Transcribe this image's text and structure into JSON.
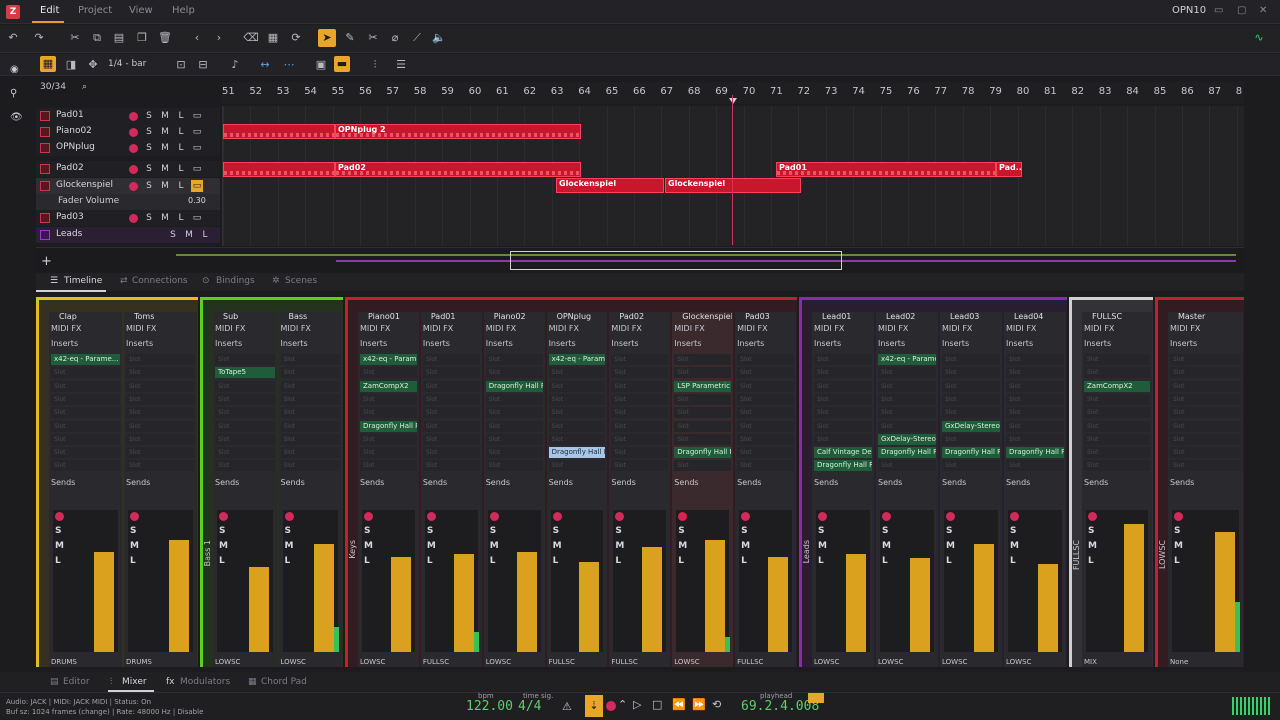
{
  "app": {
    "window_title": "OPN10"
  },
  "menu": {
    "edit": "Edit",
    "project": "Project",
    "view": "View",
    "help": "Help"
  },
  "toolbar2": {
    "snap": "1/4 - bar",
    "track_count": "30/34"
  },
  "ruler": {
    "bars": [
      "51",
      "52",
      "53",
      "54",
      "55",
      "56",
      "57",
      "58",
      "59",
      "60",
      "61",
      "62",
      "63",
      "64",
      "65",
      "66",
      "67",
      "68",
      "69",
      "70",
      "71",
      "72",
      "73",
      "74",
      "75",
      "76",
      "77",
      "78",
      "79",
      "80",
      "81",
      "82",
      "83",
      "84",
      "85",
      "86",
      "87",
      "8"
    ]
  },
  "tracks": [
    {
      "name": "Pad01"
    },
    {
      "name": "Piano02"
    },
    {
      "name": "OPNplug"
    },
    {
      "name": "Pad02"
    },
    {
      "name": "Glockenspiel"
    },
    {
      "name": "Fader Volume",
      "value": "0.30"
    },
    {
      "name": "Pad03"
    },
    {
      "name": "Leads"
    }
  ],
  "regions": {
    "opnplug": "OPNplug 2",
    "pad02": "Pad02",
    "glock1": "Glockenspiel",
    "glock2": "Glockenspiel",
    "pad01": "Pad01",
    "pad_end": "Pad..."
  },
  "tabs": {
    "timeline": "Timeline",
    "connections": "Connections",
    "bindings": "Bindings",
    "scenes": "Scenes"
  },
  "mixer": {
    "labels": {
      "midi_fx": "MIDI FX",
      "inserts": "Inserts",
      "sends": "Sends",
      "slot": "Slot"
    },
    "strips": [
      {
        "name": "Clap",
        "out": "DRUMS"
      },
      {
        "name": "Toms",
        "out": "DRUMS"
      },
      {
        "name": "Sub",
        "out": "LOWSC"
      },
      {
        "name": "Bass",
        "out": "LOWSC"
      },
      {
        "name": "Piano01",
        "out": "LOWSC"
      },
      {
        "name": "Pad01",
        "out": "FULLSC"
      },
      {
        "name": "Piano02",
        "out": "LOWSC"
      },
      {
        "name": "OPNplug",
        "out": "FULLSC"
      },
      {
        "name": "Pad02",
        "out": "FULLSC"
      },
      {
        "name": "Glockenspiel",
        "out": "LOWSC"
      },
      {
        "name": "Pad03",
        "out": "FULLSC"
      },
      {
        "name": "Lead01",
        "out": "LOWSC"
      },
      {
        "name": "Lead02",
        "out": "LOWSC"
      },
      {
        "name": "Lead03",
        "out": "LOWSC"
      },
      {
        "name": "Lead04",
        "out": "LOWSC"
      },
      {
        "name": "FULLSC",
        "out": "MIX"
      },
      {
        "name": "Master",
        "out": "None"
      }
    ],
    "plugins": {
      "x42": "x42-eq - Parame...",
      "tape": "ToTape5",
      "zam": "ZamCompX2",
      "dragonfly": "Dragonfly Hall R...",
      "lsp": "LSP Parametric ...",
      "calf": "Calf Vintage Delay",
      "gx": "GxDelay-Stereo"
    },
    "groups": {
      "bass": "Bass 1",
      "keys": "Keys",
      "leads": "Leads",
      "fullsc": "FULLSC",
      "lowsc": "LOWSC"
    }
  },
  "bottom_tabs": {
    "editor": "Editor",
    "mixer": "Mixer",
    "modulators": "Modulators",
    "chord_pad": "Chord Pad"
  },
  "transport": {
    "bpm_label": "bpm",
    "bpm": "122.00",
    "timesig_label": "time sig.",
    "timesig": "4/4",
    "playhead_label": "playhead",
    "playhead": "69.2.4.008"
  },
  "status": {
    "line1": "Audio: JACK | MIDI: JACK MIDI | Status: On",
    "line2": "Buf sz: 1024 frames (change) | Rate: 48000 Hz | Disable"
  }
}
